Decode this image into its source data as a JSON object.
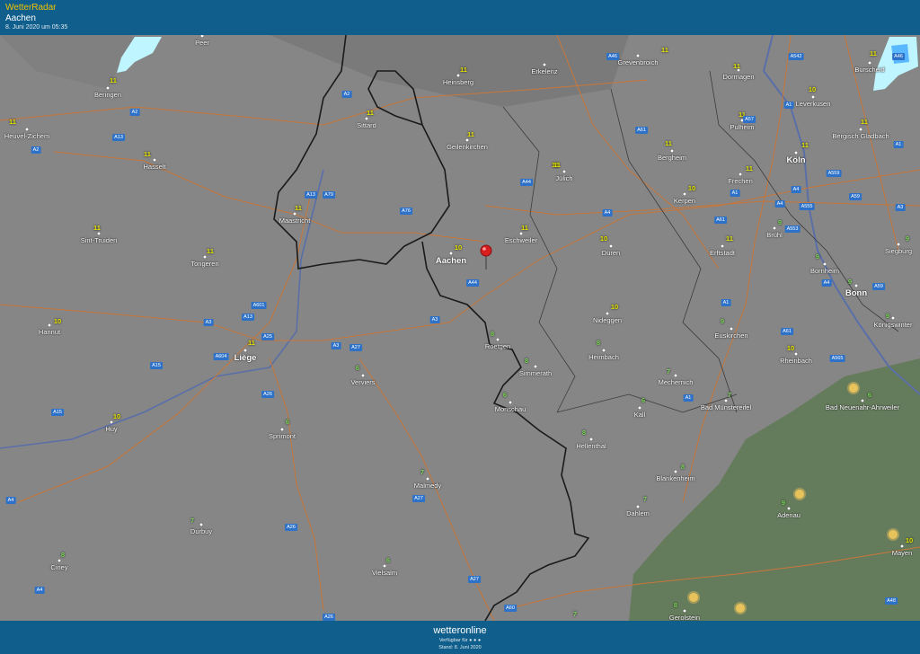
{
  "header": {
    "app_title": "WetterRadar",
    "location": "Aachen",
    "timestamp": "8. Juni 2020 um 05:35"
  },
  "footer": {
    "brand": "wetteronline",
    "provided_by": "Verfügbar für ● ● ●",
    "status": "Stand: 8. Juni 2020"
  },
  "colors": {
    "header_bg": "#0f5e8b",
    "map_bg": "#868686",
    "border": "#1a1a1a",
    "roads": "#c8773a",
    "forest": "#5f7a55",
    "river": "#5a6fa8",
    "rain_light": "#bff5ff",
    "rain_medium": "#59b8ff",
    "temp_yellow": "#e6e600",
    "temp_green": "#7cd65a",
    "pin": "#d81e1e"
  },
  "cities": [
    {
      "name": "Peer"
    },
    {
      "name": "Beringen"
    },
    {
      "name": "Heuvel-Zichem"
    },
    {
      "name": "Hasselt"
    },
    {
      "name": "Sint-Truiden"
    },
    {
      "name": "Tongeren"
    },
    {
      "name": "Hannut"
    },
    {
      "name": "Huy"
    },
    {
      "name": "Liège"
    },
    {
      "name": "Maastricht"
    },
    {
      "name": "Sittard"
    },
    {
      "name": "Heinsberg"
    },
    {
      "name": "Geilenkirchen"
    },
    {
      "name": "Erkelenz"
    },
    {
      "name": "Grevenbroich"
    },
    {
      "name": "Dormagen"
    },
    {
      "name": "Burscheid"
    },
    {
      "name": "Leverkusen"
    },
    {
      "name": "Pulheim"
    },
    {
      "name": "Bergheim"
    },
    {
      "name": "Jülich"
    },
    {
      "name": "Eschweiler"
    },
    {
      "name": "Aachen"
    },
    {
      "name": "Düren"
    },
    {
      "name": "Kerpen"
    },
    {
      "name": "Frechen"
    },
    {
      "name": "Köln"
    },
    {
      "name": "Bergisch Gladbach"
    },
    {
      "name": "Erftstadt"
    },
    {
      "name": "Brühl"
    },
    {
      "name": "Siegburg"
    },
    {
      "name": "Bornheim"
    },
    {
      "name": "Bonn"
    },
    {
      "name": "Königswinter"
    },
    {
      "name": "Nideggen"
    },
    {
      "name": "Euskirchen"
    },
    {
      "name": "Rheinbach"
    },
    {
      "name": "Heimbach"
    },
    {
      "name": "Roetgen"
    },
    {
      "name": "Simmerath"
    },
    {
      "name": "Verviers"
    },
    {
      "name": "Monschau"
    },
    {
      "name": "Mechernich"
    },
    {
      "name": "Kall"
    },
    {
      "name": "Bad Münstereifel"
    },
    {
      "name": "Bad Neuenahr-Ahrweiler"
    },
    {
      "name": "Hellenthal"
    },
    {
      "name": "Sprimont"
    },
    {
      "name": "Blankenheim"
    },
    {
      "name": "Malmedy"
    },
    {
      "name": "Dahlem"
    },
    {
      "name": "Adenau"
    },
    {
      "name": "Durbuy"
    },
    {
      "name": "Mayen"
    },
    {
      "name": "Ciney"
    },
    {
      "name": "Vielsalm"
    },
    {
      "name": "Gerolstein"
    }
  ],
  "temperatures": [
    {
      "value": "11"
    },
    {
      "value": "11"
    },
    {
      "value": "11"
    },
    {
      "value": "11"
    },
    {
      "value": "11"
    },
    {
      "value": "10"
    },
    {
      "value": "10"
    },
    {
      "value": "11"
    },
    {
      "value": "11"
    },
    {
      "value": "11"
    },
    {
      "value": "11"
    },
    {
      "value": "11"
    },
    {
      "value": "11"
    },
    {
      "value": "11"
    },
    {
      "value": "11"
    },
    {
      "value": "11"
    },
    {
      "value": "10"
    },
    {
      "value": "11"
    },
    {
      "value": "11"
    },
    {
      "value": "11"
    },
    {
      "value": "11"
    },
    {
      "value": "10"
    },
    {
      "value": "10"
    },
    {
      "value": "10"
    },
    {
      "value": "11"
    },
    {
      "value": "11"
    },
    {
      "value": "11"
    },
    {
      "value": "11"
    },
    {
      "value": "9"
    },
    {
      "value": "9"
    },
    {
      "value": "9"
    },
    {
      "value": "9"
    },
    {
      "value": "10"
    },
    {
      "value": "9"
    },
    {
      "value": "9"
    },
    {
      "value": "10"
    },
    {
      "value": "8"
    },
    {
      "value": "8"
    },
    {
      "value": "8"
    },
    {
      "value": "6"
    },
    {
      "value": "6"
    },
    {
      "value": "7"
    },
    {
      "value": "6"
    },
    {
      "value": "7"
    },
    {
      "value": "6"
    },
    {
      "value": "8"
    },
    {
      "value": "6"
    },
    {
      "value": "8"
    },
    {
      "value": "7"
    },
    {
      "value": "7"
    },
    {
      "value": "9"
    },
    {
      "value": "7"
    },
    {
      "value": "10"
    },
    {
      "value": "8"
    },
    {
      "value": "6"
    },
    {
      "value": "7"
    },
    {
      "value": "8"
    }
  ],
  "roads": [
    "A2",
    "A2",
    "A13",
    "A2",
    "A79",
    "A13",
    "A76",
    "A601",
    "A3",
    "A25",
    "A13",
    "A604",
    "A3",
    "A27",
    "A15",
    "A26",
    "A15",
    "A27",
    "A26",
    "A4",
    "A4",
    "A26",
    "A46",
    "A61",
    "A44",
    "A4",
    "A44",
    "A3",
    "A27",
    "A60",
    "A46",
    "A542",
    "A1",
    "A57",
    "A1",
    "A4",
    "A61",
    "A1",
    "A4",
    "A555",
    "A553",
    "A559",
    "A59",
    "A3",
    "A59",
    "A1",
    "A61",
    "A565",
    "A48",
    "A1",
    "A4"
  ],
  "pin": {
    "label": "Aachen location marker"
  }
}
